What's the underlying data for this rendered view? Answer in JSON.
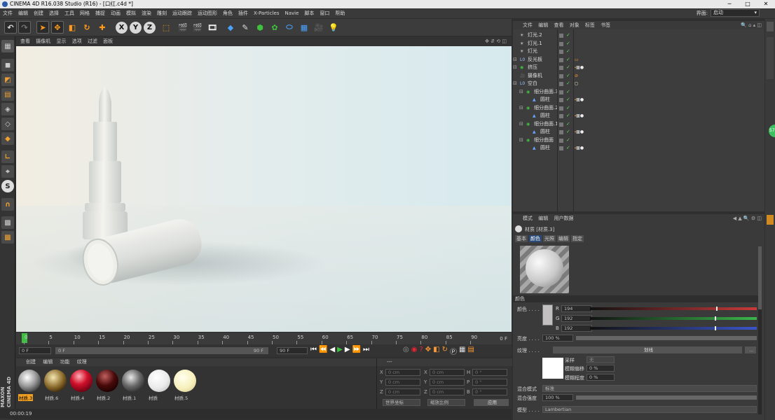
{
  "window": {
    "title": "CINEMA 4D R16.038 Studio (R16) - [口红.c4d *]",
    "controls": [
      "─",
      "□",
      "✕"
    ]
  },
  "menu": [
    "文件",
    "编辑",
    "创建",
    "选择",
    "工具",
    "网格",
    "捕捉",
    "动画",
    "模拟",
    "渲染",
    "雕刻",
    "运动跟踪",
    "运动图形",
    "角色",
    "插件",
    "X-Particles",
    "Navie",
    "脚本",
    "窗口",
    "帮助"
  ],
  "layout": {
    "label": "界面:",
    "value": "启动"
  },
  "toolbar": {
    "undo": "↶",
    "redo": "↷",
    "x": "X",
    "y": "Y",
    "z": "Z"
  },
  "viewport_menu": [
    "查看",
    "摄像机",
    "显示",
    "选项",
    "过滤",
    "面板"
  ],
  "timeline": {
    "ticks": [
      "0",
      "5",
      "10",
      "15",
      "20",
      "25",
      "30",
      "35",
      "40",
      "45",
      "50",
      "55",
      "60",
      "65",
      "70",
      "75",
      "80",
      "85",
      "90"
    ],
    "end_label": "0 F",
    "current_frame": "0 F",
    "start_field": "0 F",
    "end_field": "90 F",
    "max_field": "90 F"
  },
  "materials": {
    "menu": [
      "创建",
      "编辑",
      "功能",
      "纹理"
    ],
    "items": [
      {
        "label": "材质.3",
        "type": "chrome",
        "selected": true
      },
      {
        "label": "材质.6",
        "type": "gold"
      },
      {
        "label": "材质.4",
        "type": "red"
      },
      {
        "label": "材质.2",
        "type": "darkred"
      },
      {
        "label": "材质.1",
        "type": "chrome2"
      },
      {
        "label": "材质",
        "type": "white"
      },
      {
        "label": "材质.5",
        "type": "cream"
      }
    ],
    "logo_lines": [
      "MAXON",
      "CINEMA 4D"
    ]
  },
  "coords": {
    "header": "---",
    "rows": [
      {
        "a": "X",
        "av": "0 cm",
        "b": "X",
        "bv": "0 cm",
        "c": "H",
        "cv": "0 °"
      },
      {
        "a": "Y",
        "av": "0 cm",
        "b": "Y",
        "bv": "0 cm",
        "c": "P",
        "cv": "0 °"
      },
      {
        "a": "Z",
        "av": "0 cm",
        "b": "Z",
        "bv": "0 cm",
        "c": "B",
        "cv": "0 °"
      }
    ],
    "world": "世界坐标",
    "scale": "缩放比例",
    "apply": "应用"
  },
  "status": {
    "time": "00:00:19"
  },
  "objects": {
    "menu": [
      "文件",
      "编辑",
      "查看",
      "对象",
      "标签",
      "书签"
    ],
    "rows": [
      {
        "name": "灯光.2",
        "indent": 0,
        "icon": "light-icon"
      },
      {
        "name": "灯光.1",
        "indent": 0,
        "icon": "light-icon"
      },
      {
        "name": "灯光",
        "indent": 0,
        "icon": "light-icon"
      },
      {
        "name": "反光板",
        "indent": 0,
        "icon": "null-icon",
        "expand": true
      },
      {
        "name": "挤压",
        "indent": 0,
        "icon": "extrude-icon",
        "expand": true
      },
      {
        "name": "摄像机",
        "indent": 0,
        "icon": "camera-icon"
      },
      {
        "name": "空白",
        "indent": 0,
        "icon": "null-icon",
        "expand": true
      },
      {
        "name": "细分曲面.3",
        "indent": 1,
        "icon": "subdivision-icon",
        "expand": true
      },
      {
        "name": "圆柱",
        "indent": 2,
        "icon": "cylinder-icon"
      },
      {
        "name": "细分曲面.2",
        "indent": 1,
        "icon": "subdivision-icon",
        "expand": true
      },
      {
        "name": "圆柱",
        "indent": 2,
        "icon": "cylinder-icon"
      },
      {
        "name": "细分曲面.1",
        "indent": 1,
        "icon": "subdivision-icon",
        "expand": true
      },
      {
        "name": "圆柱",
        "indent": 2,
        "icon": "cylinder-icon"
      },
      {
        "name": "细分曲面",
        "indent": 1,
        "icon": "subdivision-icon",
        "expand": true
      },
      {
        "name": "圆柱",
        "indent": 2,
        "icon": "cylinder-icon"
      }
    ]
  },
  "attributes": {
    "menu": [
      "模式",
      "编辑",
      "用户数据"
    ],
    "title": "材质 [材质.3]",
    "tabs": [
      "基本",
      "颜色",
      "光照",
      "编辑",
      "指定"
    ],
    "active_tab": "颜色",
    "section": "颜色",
    "color_label": "颜色 . . . .",
    "rgb": [
      {
        "ch": "R",
        "v": "194",
        "color": "#c93a3a"
      },
      {
        "ch": "G",
        "v": "192",
        "color": "#3ab54a"
      },
      {
        "ch": "B",
        "v": "192",
        "color": "#3a55c9"
      }
    ],
    "brightness_label": "亮度 . . . .",
    "brightness": "100 %",
    "texture_label": "纹理 . . . .",
    "texture_button": "划线",
    "texture_more": "...",
    "sampling_label": "采样",
    "sampling": "无",
    "blur_offset_label": "模糊偏移",
    "blur_offset": "0 %",
    "blur_scale_label": "模糊程度",
    "blur_scale": "0 %",
    "mix_mode_label": "混合模式",
    "mix_mode": "标准",
    "mix_strength_label": "混合强度",
    "mix_strength": "100 %",
    "model_label": "模型 . . . .",
    "model": "Lambertian"
  },
  "side_badge": "57"
}
